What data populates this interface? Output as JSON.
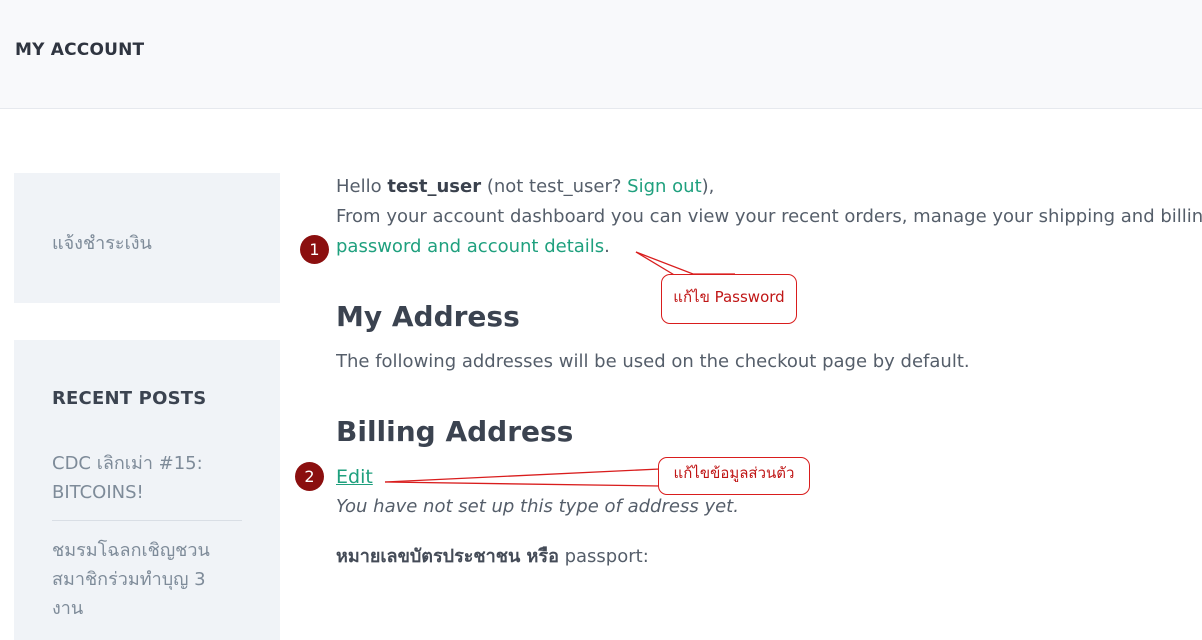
{
  "header": {
    "title": "MY ACCOUNT"
  },
  "sidebar": {
    "payment_link": "แจ้งชำระเงิน",
    "recent_posts": {
      "title": "RECENT POSTS",
      "posts": [
        "CDC เลิกเม่า #15: BITCOINS!",
        "ชมรมโฉลกเชิญชวน สมาชิกร่วมทำบุญ 3 งาน"
      ]
    }
  },
  "main": {
    "hello_prefix": "Hello ",
    "username": "test_user",
    "not_user_prefix": " (not test_user? ",
    "sign_out": "Sign out",
    "not_user_suffix": "),",
    "dashboard_text": "From your account dashboard you can view your recent orders, manage your shipping and billing addresses and edit your",
    "account_details_link": "password and account details",
    "details_suffix": ".",
    "my_address_heading": "My Address",
    "address_description": "The following addresses will be used on the checkout page by default.",
    "billing_heading": "Billing Address",
    "edit_link": "Edit",
    "not_set_text": "You have not set up this type of address yet.",
    "id_label": "หมายเลขบัตรประชาชน หรือ",
    "id_suffix": " passport:"
  },
  "annotations": {
    "badge_1": "1",
    "badge_2": "2",
    "callout_1": "แก้ไข Password",
    "callout_2": "แก้ไขข้อมูลส่วนตัว",
    "accent_color": "#d91d1d",
    "badge_color": "#8b0f0f"
  },
  "colors": {
    "link": "#1fa07e",
    "sidebar_bg": "#f0f3f7",
    "header_bg": "#f8f9fb"
  }
}
